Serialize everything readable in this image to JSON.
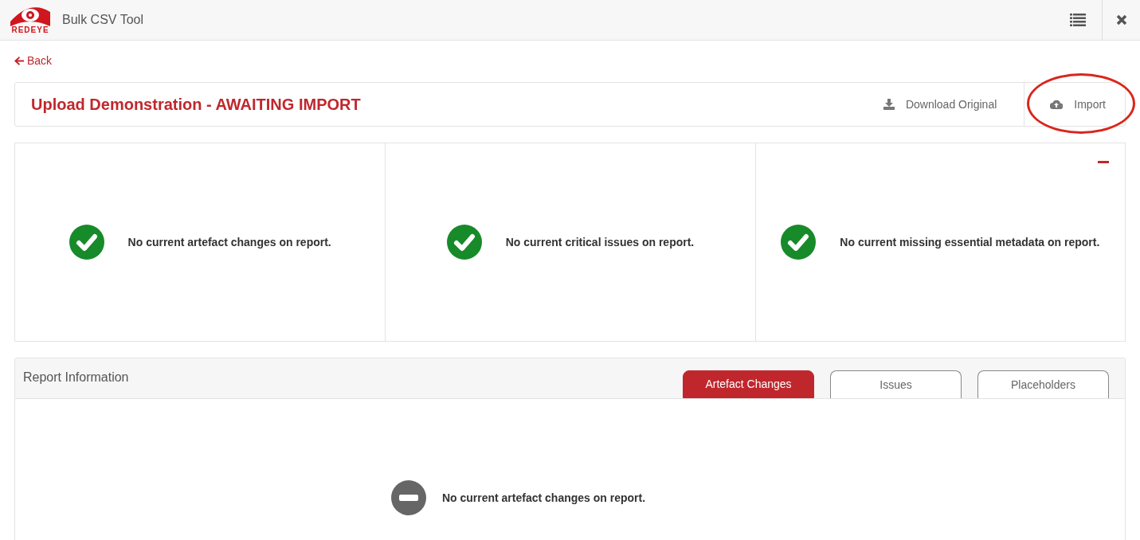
{
  "header": {
    "logo_text": "REDEYE",
    "title": "Bulk CSV Tool"
  },
  "back_link": "Back",
  "upload": {
    "title": "Upload Demonstration - AWAITING IMPORT",
    "actions": [
      {
        "kind": "download",
        "label": "Download Original",
        "highlighted": false
      },
      {
        "kind": "upload",
        "label": "Import",
        "highlighted": true
      }
    ]
  },
  "summary": {
    "collapsible": true,
    "panels": [
      {
        "kind": "ok",
        "message": "No current artefact changes on report."
      },
      {
        "kind": "ok",
        "message": "No current critical issues on report."
      },
      {
        "kind": "ok",
        "message": "No current missing essential metadata on report."
      }
    ]
  },
  "report": {
    "title": "Report Information",
    "tabs": [
      {
        "label": "Artefact Changes",
        "selected": true
      },
      {
        "label": "Issues",
        "selected": false
      },
      {
        "label": "Placeholders",
        "selected": false
      }
    ],
    "message": {
      "kind": "empty",
      "text": "No current artefact changes on report."
    }
  }
}
